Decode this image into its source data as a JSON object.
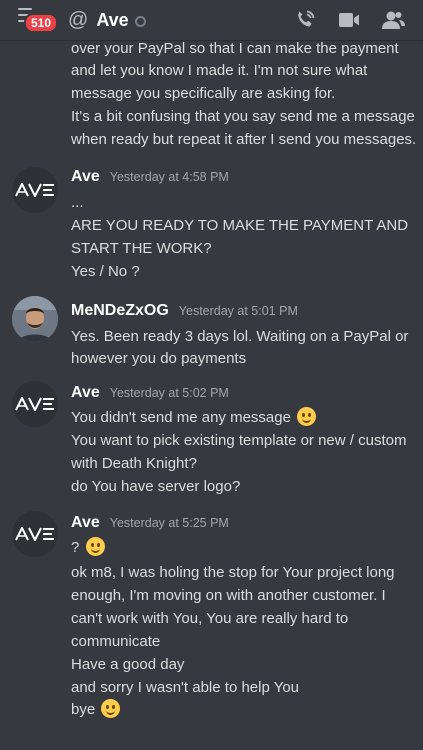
{
  "header": {
    "notification_count": "510",
    "at_symbol": "@",
    "channel_name": "Ave"
  },
  "messages": {
    "previous_lines": [
      "over your PayPal so that I can make the payment",
      "and let you know I made it. I'm not sure what",
      "message you specifically are asking for.",
      "It's a bit confusing that you say send me a message",
      "when ready but repeat it after I send you messages."
    ],
    "groups": [
      {
        "author": "Ave",
        "timestamp": "Yesterday at 4:58 PM",
        "lines": [
          "...",
          "ARE YOU READY TO MAKE THE PAYMENT AND",
          "START THE WORK?",
          "Yes / No ?"
        ]
      },
      {
        "author": "MeNDeZxOG",
        "timestamp": "Yesterday at 5:01 PM",
        "lines": [
          "Yes. Been ready 3 days lol. Waiting on a PayPal or",
          "however you do payments"
        ]
      },
      {
        "author": "Ave",
        "timestamp": "Yesterday at 5:02 PM",
        "lines": [
          "You didn't send me any message",
          "You want to pick existing template or new / custom",
          "with Death Knight?",
          "do You have server logo?"
        ]
      },
      {
        "author": "Ave",
        "timestamp": "Yesterday at 5:25 PM",
        "lines": [
          "?",
          "ok m8, I was holing the stop for Your project long",
          "enough, I'm moving on with another customer. I",
          "can't work with You, You are really hard to",
          "communicate",
          "Have a good day",
          "and sorry I wasn't able to help You",
          "bye"
        ]
      }
    ]
  },
  "icons": {
    "menu": "hamburger-menu-icon",
    "call": "phone-call-icon",
    "video": "video-camera-icon",
    "members": "member-list-icon",
    "emoji": "slightly-smiling-face-emoji"
  },
  "colors": {
    "background": "#36393f",
    "badge": "#ed4245",
    "text": "#dcddde",
    "author": "#ffffff",
    "timestamp": "#a3a6aa"
  }
}
